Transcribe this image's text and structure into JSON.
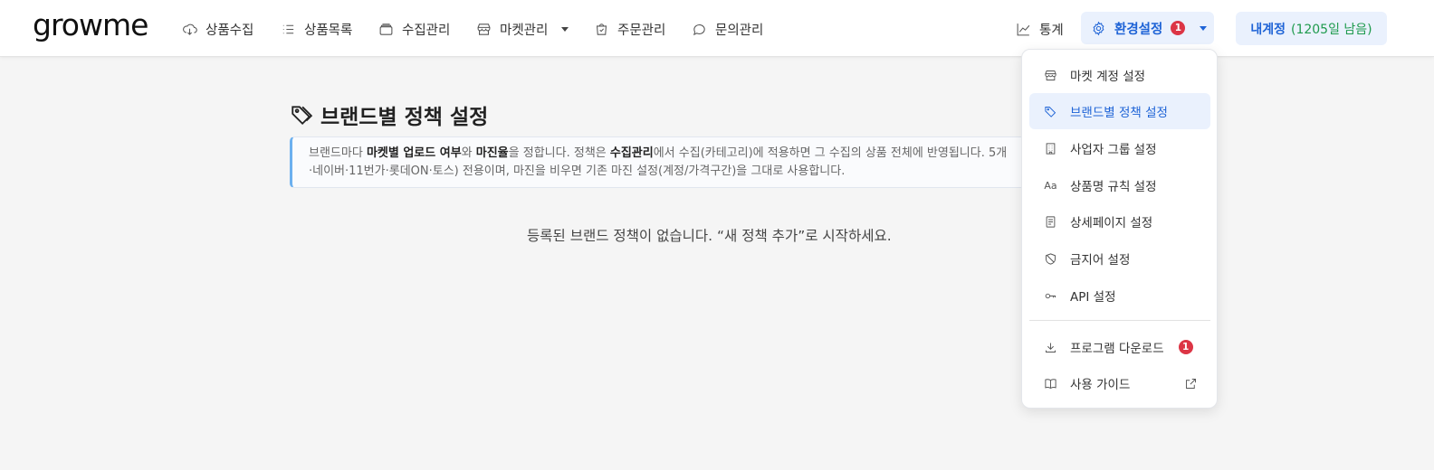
{
  "brand": {
    "logo_text": "growme"
  },
  "nav": {
    "items": [
      {
        "label": "상품수집",
        "icon": "cloud-download-icon"
      },
      {
        "label": "상품목록",
        "icon": "list-icon"
      },
      {
        "label": "수집관리",
        "icon": "folder-icon"
      },
      {
        "label": "마켓관리",
        "icon": "store-icon"
      },
      {
        "label": "주문관리",
        "icon": "shopping-bag-icon"
      },
      {
        "label": "문의관리",
        "icon": "chat-icon"
      }
    ],
    "stats_label": "통계",
    "settings_label": "환경설정",
    "settings_badge": "1",
    "account_label": "내계정",
    "account_remaining": "(1205일 남음)"
  },
  "page": {
    "title": "브랜드별 정책 설정",
    "info": {
      "t1": "브랜드마다 ",
      "b1": "마켓별 업로드 여부",
      "t2": "와 ",
      "b2": "마진율",
      "t3": "을 정합니다. 정책은 ",
      "b3": "수집관리",
      "t4": "에서 수집(카테고리)에 적용하면 그 수집의 상품 전체에 반영됩니다. 5개",
      "line2": "·네이버·11번가·롯데ON·토스) 전용이며, 마진을 비우면 기존 마진 설정(계정/가격구간)을 그대로 사용합니다."
    },
    "empty_message": "등록된 브랜드 정책이 없습니다. “새 정책 추가”로 시작하세요."
  },
  "dropdown": {
    "items": [
      {
        "label": "마켓 계정 설정",
        "icon": "store-icon"
      },
      {
        "label": "브랜드별 정책 설정",
        "icon": "tag-icon",
        "active": true
      },
      {
        "label": "사업자 그룹 설정",
        "icon": "building-icon"
      },
      {
        "label": "상품명 규칙 설정",
        "icon": "font-size-icon",
        "glyph": "Aa"
      },
      {
        "label": "상세페이지 설정",
        "icon": "document-icon"
      },
      {
        "label": "금지어 설정",
        "icon": "shield-slash-icon"
      },
      {
        "label": "API 설정",
        "icon": "key-icon"
      }
    ],
    "download_label": "프로그램 다운로드",
    "download_badge": "1",
    "guide_label": "사용 가이드"
  },
  "colors": {
    "accent": "#1e63d6",
    "accent_bg": "#eaf1fd",
    "badge": "#dc3545",
    "remaining_green": "#1e9a4d",
    "info_border": "#6cb0ef"
  }
}
